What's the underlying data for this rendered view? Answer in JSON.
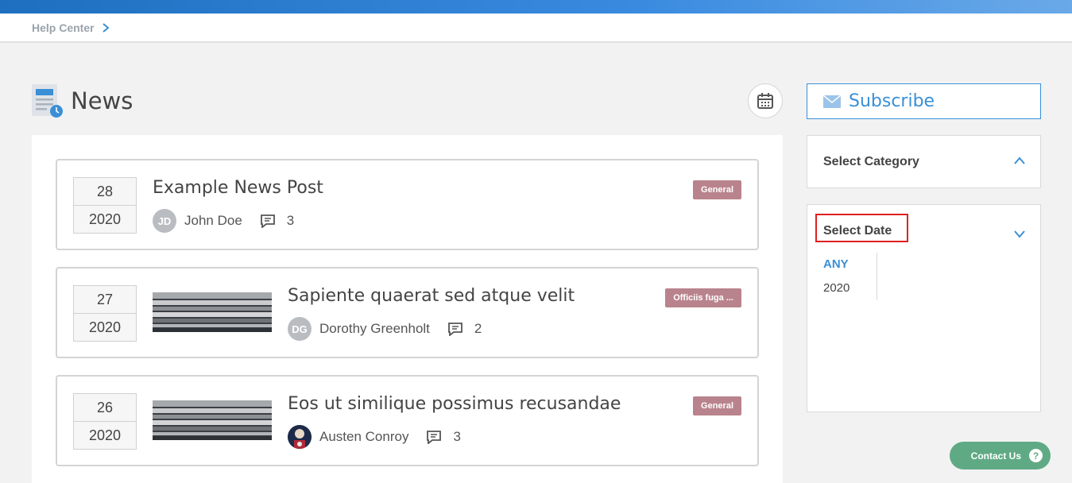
{
  "breadcrumb": {
    "label": "Help Center"
  },
  "page": {
    "title": "News"
  },
  "posts": [
    {
      "day": "28",
      "year": "2020",
      "title": "Example News Post",
      "initials": "JD",
      "author": "John Doe",
      "comments": "3",
      "tag": "General",
      "has_thumb": false
    },
    {
      "day": "27",
      "year": "2020",
      "title": "Sapiente quaerat sed atque velit",
      "initials": "DG",
      "author": "Dorothy Greenholt",
      "comments": "2",
      "tag": "Officiis fuga ...",
      "has_thumb": true
    },
    {
      "day": "26",
      "year": "2020",
      "title": "Eos ut similique possimus recusandae",
      "initials": "",
      "author": "Austen Conroy",
      "comments": "3",
      "tag": "General",
      "has_thumb": true
    }
  ],
  "sidebar": {
    "subscribe_label": "Subscribe",
    "category_title": "Select Category",
    "date_title": "Select Date",
    "date_options": [
      "ANY",
      "2020"
    ]
  },
  "contact": {
    "label": "Contact Us",
    "icon_text": "?"
  },
  "colors": {
    "accent": "#3a8fd6",
    "tag": "#b9838d",
    "contact": "#5faa85",
    "highlight": "#e02020"
  }
}
